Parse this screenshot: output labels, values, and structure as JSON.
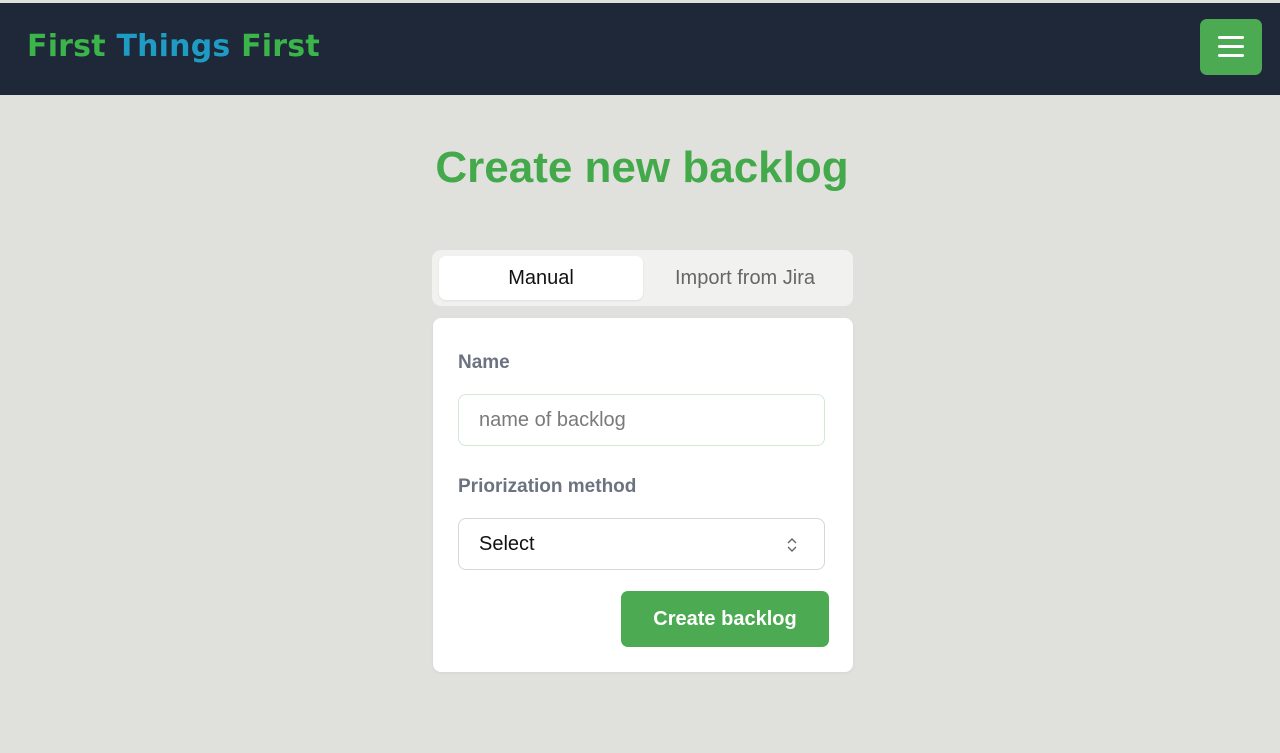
{
  "header": {
    "brand_word_1": "First",
    "brand_word_2": "Things",
    "brand_word_3": "First",
    "menu_icon": "hamburger-menu-icon",
    "menu_color": "#4caa52",
    "bg_color": "#1f2838"
  },
  "main": {
    "title": "Create new backlog",
    "title_color": "#43a94b",
    "tabs": [
      {
        "label": "Manual",
        "active": true
      },
      {
        "label": "Import from Jira",
        "active": false
      }
    ],
    "form": {
      "name_label": "Name",
      "name_placeholder": "name of backlog",
      "name_value": "",
      "method_label": "Priorization method",
      "method_selected": "Select",
      "submit_label": "Create backlog"
    }
  }
}
